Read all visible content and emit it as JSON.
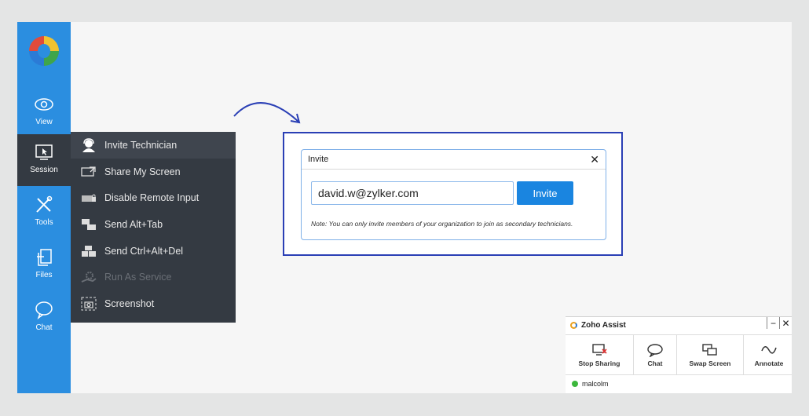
{
  "rail": {
    "items": [
      {
        "label": "View",
        "icon": "eye-icon"
      },
      {
        "label": "Session",
        "icon": "cursor-screen-icon"
      },
      {
        "label": "Tools",
        "icon": "tools-icon"
      },
      {
        "label": "Files",
        "icon": "files-icon"
      },
      {
        "label": "Chat",
        "icon": "chat-bubble-icon"
      }
    ]
  },
  "session_menu": {
    "items": [
      {
        "label": "Invite Technician",
        "icon": "headset-user-icon"
      },
      {
        "label": "Share My Screen",
        "icon": "share-screen-icon"
      },
      {
        "label": "Disable Remote Input",
        "icon": "keyboard-lock-icon"
      },
      {
        "label": "Send Alt+Tab",
        "icon": "alt-tab-icon"
      },
      {
        "label": "Send Ctrl+Alt+Del",
        "icon": "ctrl-alt-del-icon"
      },
      {
        "label": "Run As Service",
        "icon": "gear-hand-icon"
      },
      {
        "label": "Screenshot",
        "icon": "camera-icon"
      }
    ]
  },
  "invite_dialog": {
    "title": "Invite",
    "email_value": "david.w@zylker.com",
    "button_label": "Invite",
    "note": "Note: You can only invite members of your organization to join as secondary technicians."
  },
  "zoho_assist": {
    "title": "Zoho Assist",
    "tools": [
      {
        "label": "Stop Sharing",
        "icon": "stop-sharing-icon"
      },
      {
        "label": "Chat",
        "icon": "chat-bubble-icon"
      },
      {
        "label": "Swap Screen",
        "icon": "swap-screen-icon"
      },
      {
        "label": "Annotate",
        "icon": "annotate-wave-icon"
      }
    ],
    "user": "malcolm"
  },
  "colors": {
    "rail_blue": "#2b8ee0",
    "menu_dark": "#343a42",
    "highlight_frame": "#2a3fb5",
    "invite_button": "#1a85e0"
  }
}
